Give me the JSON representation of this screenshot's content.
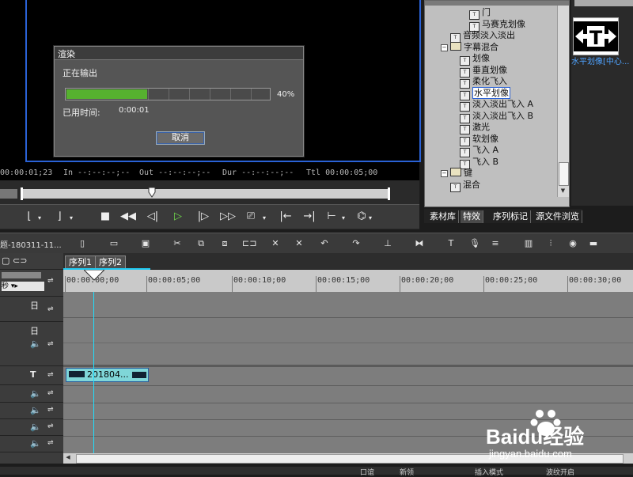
{
  "preview": {
    "timecodes": {
      "current": "00:00:01;23",
      "in": "In --:--:--;--",
      "out": "Out --:--:--;--",
      "dur": "Dur --:--:--;--",
      "ttl": "Ttl 00:00:05;00"
    }
  },
  "render_dialog": {
    "title": "渲染",
    "status": "正在输出",
    "progress_percent": 40,
    "progress_label": "40%",
    "elapsed_label": "已用时间:",
    "elapsed_value": "0:00:01",
    "cancel_label": "取消"
  },
  "effects_tree": {
    "items": [
      {
        "label": "门",
        "indent": 4,
        "icon": "effect"
      },
      {
        "label": "马赛克划像",
        "indent": 4,
        "icon": "effect"
      },
      {
        "label": "音频淡入淡出",
        "indent": 2,
        "icon": "effect"
      },
      {
        "label": "字幕混合",
        "indent": 1,
        "icon": "folder",
        "expanded": true
      },
      {
        "label": "划像",
        "indent": 3,
        "icon": "effect"
      },
      {
        "label": "垂直划像",
        "indent": 3,
        "icon": "effect"
      },
      {
        "label": "柔化飞入",
        "indent": 3,
        "icon": "effect"
      },
      {
        "label": "水平划像",
        "indent": 3,
        "icon": "effect",
        "selected": true
      },
      {
        "label": "淡入淡出飞入 A",
        "indent": 3,
        "icon": "effect"
      },
      {
        "label": "淡入淡出飞入 B",
        "indent": 3,
        "icon": "effect"
      },
      {
        "label": "激光",
        "indent": 3,
        "icon": "effect"
      },
      {
        "label": "软划像",
        "indent": 3,
        "icon": "effect"
      },
      {
        "label": "飞入 A",
        "indent": 3,
        "icon": "effect"
      },
      {
        "label": "飞入 B",
        "indent": 3,
        "icon": "effect"
      },
      {
        "label": "键",
        "indent": 1,
        "icon": "folder",
        "expanded": true
      },
      {
        "label": "混合",
        "indent": 2,
        "icon": "effect"
      }
    ]
  },
  "panel_tabs": [
    "素材库",
    "特效",
    "序列标记",
    "源文件浏览"
  ],
  "effect_preview": {
    "label": "水平划像[中心..."
  },
  "toolbar": {
    "project_title": "题-180311-11..."
  },
  "sequence_tabs": [
    "序列1",
    "序列2"
  ],
  "ruler": {
    "ticks": [
      "00:00:00;00",
      "00:00:05;00",
      "00:00:10;00",
      "00:00:15;00",
      "00:00:20;00",
      "00:00:25;00",
      "00:00:30;00"
    ]
  },
  "track_labels": {
    "row1": "日",
    "row2": "日",
    "title_icon": "T"
  },
  "clip": {
    "label": "201804..."
  },
  "statusbar": {
    "items": [
      "口谊",
      "新领",
      "插入模式",
      "波纹开启"
    ]
  },
  "watermark": {
    "brand": "Baidu经验",
    "url": "jingyan.baidu.com"
  }
}
